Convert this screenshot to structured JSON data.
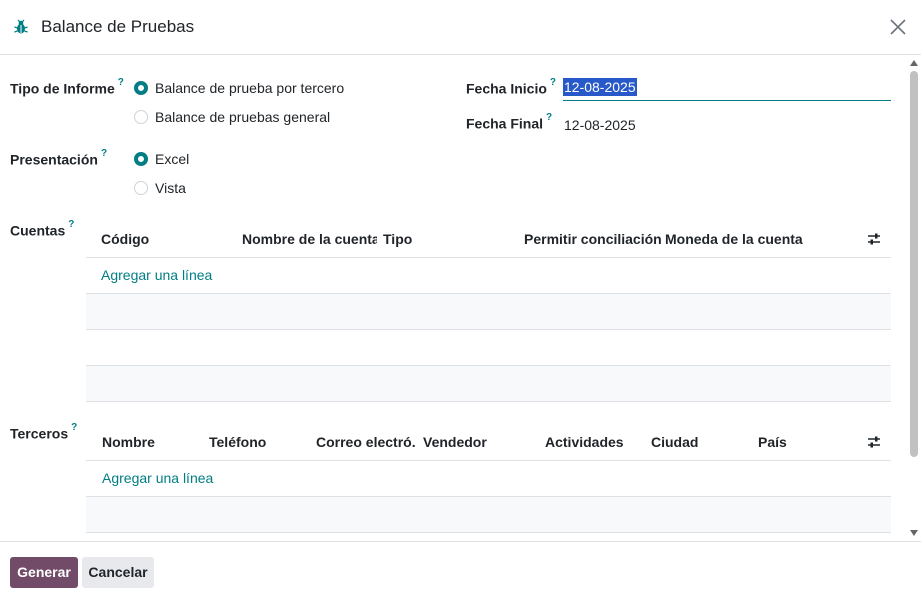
{
  "dialog": {
    "title": "Balance de Pruebas",
    "icon": "bug-icon",
    "accent": "#017e84"
  },
  "tooltip_mark": "?",
  "form": {
    "tipo_informe": {
      "label": "Tipo de Informe",
      "options": [
        {
          "label": "Balance de prueba por tercero",
          "selected": true
        },
        {
          "label": "Balance de pruebas general",
          "selected": false
        }
      ]
    },
    "presentacion": {
      "label": "Presentación",
      "options": [
        {
          "label": "Excel",
          "selected": true
        },
        {
          "label": "Vista",
          "selected": false
        }
      ]
    },
    "fecha_inicio": {
      "label": "Fecha Inicio",
      "value": "12-08-2025"
    },
    "fecha_final": {
      "label": "Fecha Final",
      "value": "12-08-2025"
    }
  },
  "cuentas": {
    "label": "Cuentas",
    "columns": [
      "Código",
      "Nombre de la cuenta",
      "Tipo",
      "Permitir conciliación",
      "Moneda de la cuenta"
    ],
    "add_line": "Agregar una línea"
  },
  "terceros": {
    "label": "Terceros",
    "columns": [
      "Nombre",
      "Teléfono",
      "Correo electró...",
      "Vendedor",
      "Actividades",
      "Ciudad",
      "País"
    ],
    "add_line": "Agregar una línea"
  },
  "footer": {
    "generate_label": "Generar",
    "cancel_label": "Cancelar",
    "primary_color": "#714b67"
  }
}
